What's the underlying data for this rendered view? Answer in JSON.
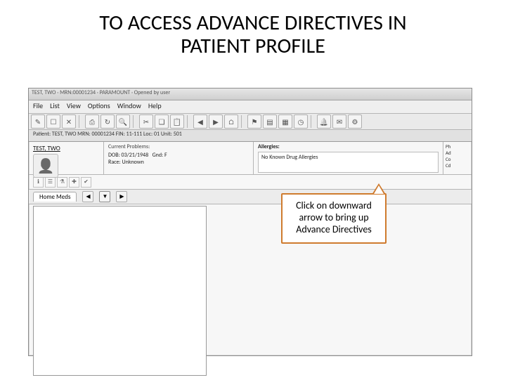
{
  "title_line1": "TO ACCESS ADVANCE DIRECTIVES IN",
  "title_line2": "PATIENT PROFILE",
  "titlebar": "TEST, TWO · MRN:00001234 · PARAMOUNT · Opened by user",
  "menus": {
    "file": "File",
    "list": "List",
    "view": "View",
    "options": "Options",
    "window": "Window",
    "help": "Help"
  },
  "patientbar": "Patient: TEST, TWO  MRN: 00001234  FIN: 11-111  Loc: 01  Unit: 501",
  "patient": {
    "name": "TEST, TWO",
    "dob_label": "DOB:",
    "dob": "03/21/1948",
    "gnd_label": "Gnd:",
    "gnd": "F",
    "race_label": "Race:",
    "race": "Unknown",
    "problems_header": "Current Problems:"
  },
  "allergies": {
    "label": "Allergies:",
    "value": "No Known Drug Allergies"
  },
  "right": {
    "a": "Ph",
    "b": "Ad",
    "c": "Co",
    "d": "Cd"
  },
  "tab": {
    "homemeds": "Home Meds"
  },
  "callout": "Click on downward arrow to bring up Advance Directives"
}
